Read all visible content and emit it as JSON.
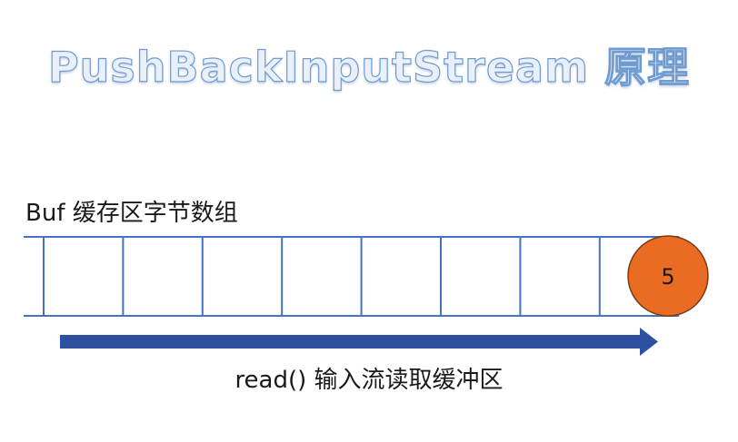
{
  "title": "PushBackInputStream 原理",
  "buffer": {
    "label": "Buf 缓存区字节数组",
    "cell_count": 8,
    "pushed_back_value": "5",
    "pushed_back_cell_index": 7
  },
  "read_arrow": {
    "caption": "read() 输入流读取缓冲区"
  },
  "colors": {
    "grid_line": "#4472c4",
    "arrow": "#2e50a0",
    "circle_fill": "#ea6b22",
    "circle_stroke": "#7a3c17",
    "title_outline": "#6f9bd0"
  }
}
